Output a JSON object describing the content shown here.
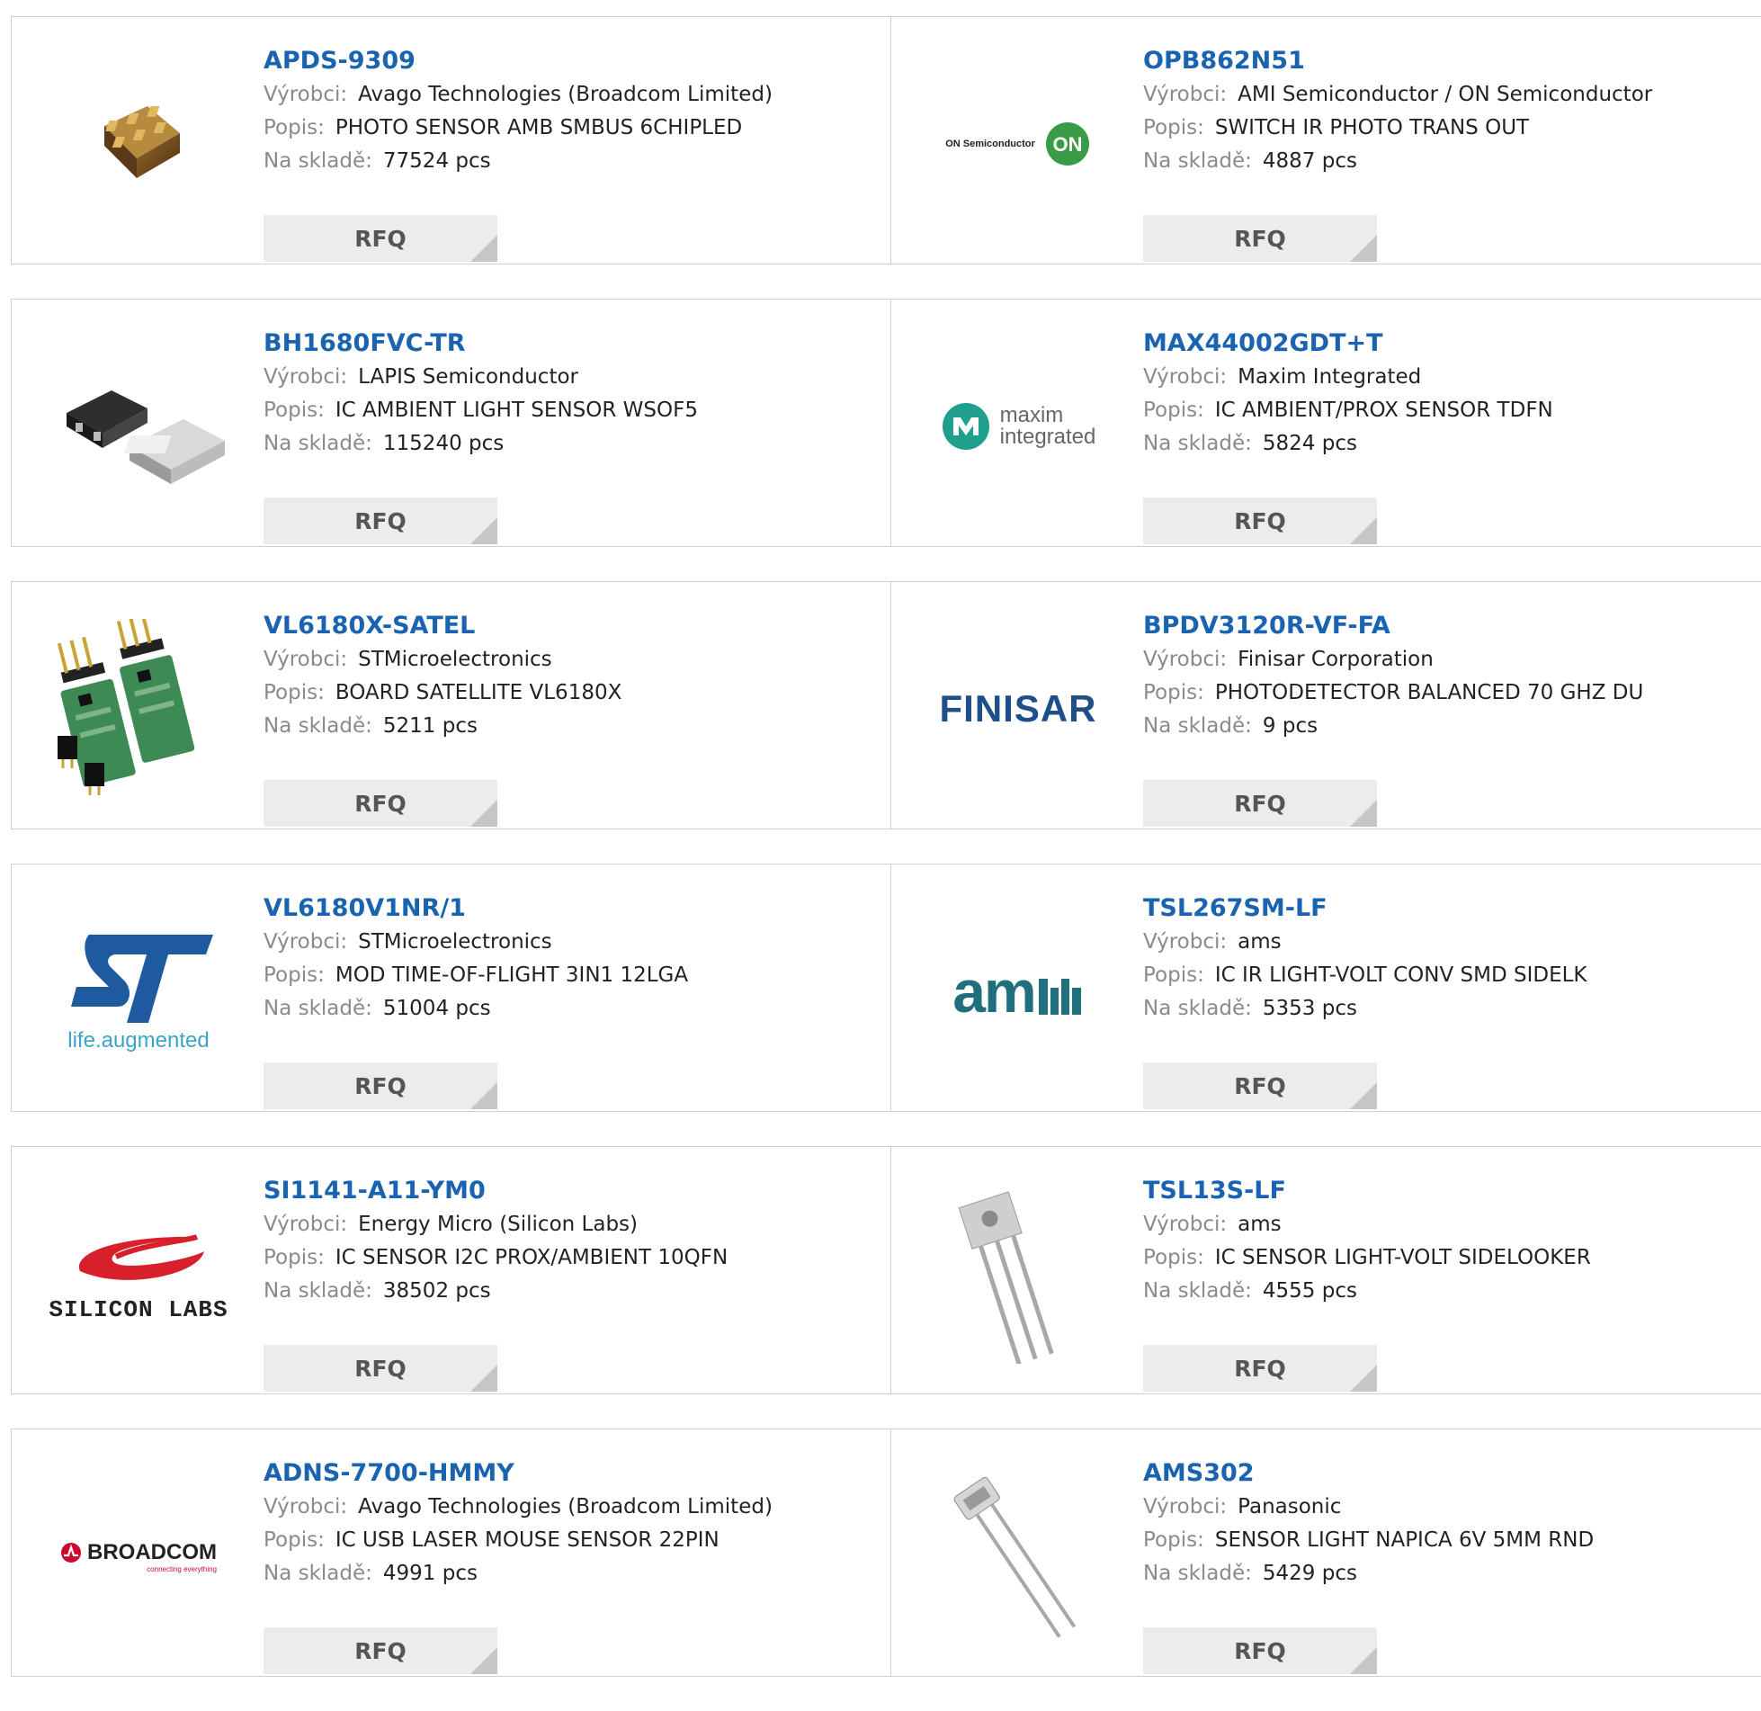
{
  "labels": {
    "manufacturer": "Výrobci:",
    "description": "Popis:",
    "stock": "Na skladě:",
    "rfq": "RFQ"
  },
  "colors": {
    "link": "#1a63b0",
    "label": "#8a8a8a",
    "button_bg": "#ececec",
    "border": "#cfcfcf"
  },
  "products": [
    {
      "part": "APDS-9309",
      "manufacturer": "Avago Technologies (Broadcom Limited)",
      "description": "PHOTO SENSOR AMB SMBUS 6CHIPLED",
      "stock": "77524 pcs",
      "image": "chipled-package-photo"
    },
    {
      "part": "OPB862N51",
      "manufacturer": "AMI Semiconductor / ON Semiconductor",
      "description": "SWITCH IR PHOTO TRANS OUT",
      "stock": "4887 pcs",
      "image": "on-semiconductor-logo",
      "logo_text": "ON Semiconductor",
      "logo_badge": "ON"
    },
    {
      "part": "BH1680FVC-TR",
      "manufacturer": "LAPIS Semiconductor",
      "description": "IC AMBIENT LIGHT SENSOR WSOF5",
      "stock": "115240 pcs",
      "image": "wsof5-package-photo"
    },
    {
      "part": "MAX44002GDT+T",
      "manufacturer": "Maxim Integrated",
      "description": "IC AMBIENT/PROX SENSOR TDFN",
      "stock": "5824 pcs",
      "image": "maxim-integrated-logo",
      "logo_text": [
        "maxim",
        "integrated"
      ]
    },
    {
      "part": "VL6180X-SATEL",
      "manufacturer": "STMicroelectronics",
      "description": "BOARD SATELLITE VL6180X",
      "stock": "5211 pcs",
      "image": "satellite-board-photo"
    },
    {
      "part": "BPDV3120R-VF-FA",
      "manufacturer": "Finisar Corporation",
      "description": "PHOTODETECTOR BALANCED 70 GHZ DU",
      "stock": "9 pcs",
      "image": "finisar-logo",
      "logo_text": "FINISAR"
    },
    {
      "part": "VL6180V1NR/1",
      "manufacturer": "STMicroelectronics",
      "description": "MOD TIME-OF-FLIGHT 3IN1 12LGA",
      "stock": "51004 pcs",
      "image": "st-life-augmented-logo",
      "logo_text": "life.augmented"
    },
    {
      "part": "TSL267SM-LF",
      "manufacturer": "ams",
      "description": "IC IR LIGHT-VOLT CONV SMD SIDELK",
      "stock": "5353 pcs",
      "image": "ams-logo",
      "logo_text": "am"
    },
    {
      "part": "SI1141-A11-YM0",
      "manufacturer": "Energy Micro (Silicon Labs)",
      "description": "IC SENSOR I2C PROX/AMBIENT 10QFN",
      "stock": "38502 pcs",
      "image": "silicon-labs-logo",
      "logo_text": "SILICON LABS"
    },
    {
      "part": "TSL13S-LF",
      "manufacturer": "ams",
      "description": "IC SENSOR LIGHT-VOLT SIDELOOKER",
      "stock": "4555 pcs",
      "image": "sidelooker-sensor-photo"
    },
    {
      "part": "ADNS-7700-HMMY",
      "manufacturer": "Avago Technologies (Broadcom Limited)",
      "description": "IC USB LASER MOUSE SENSOR 22PIN",
      "stock": "4991 pcs",
      "image": "broadcom-logo",
      "logo_text": "BROADCOM",
      "logo_tagline": "connecting everything"
    },
    {
      "part": "AMS302",
      "manufacturer": "Panasonic",
      "description": "SENSOR LIGHT NAPICA 6V 5MM RND",
      "stock": "5429 pcs",
      "image": "photo-sensor-leads-photo"
    }
  ]
}
